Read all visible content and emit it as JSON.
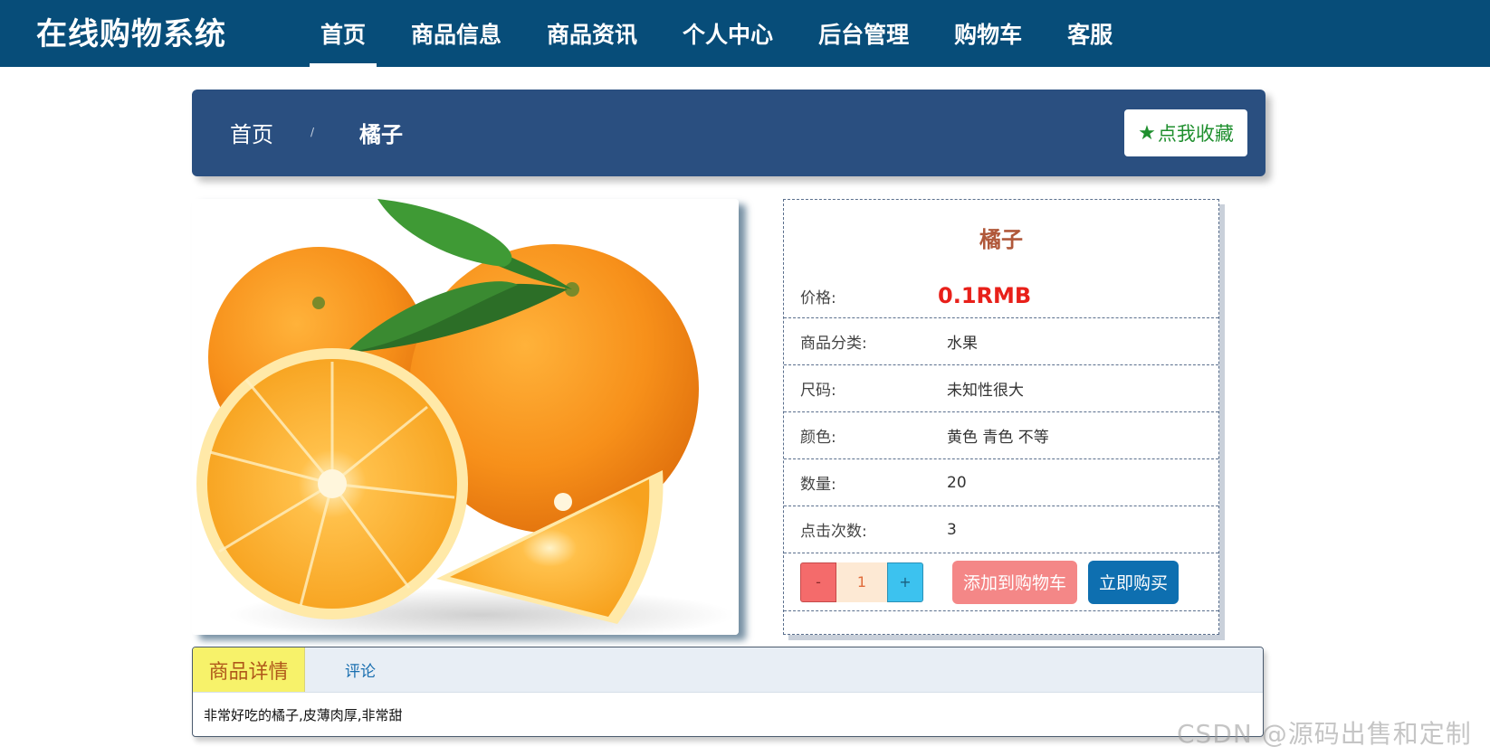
{
  "app": {
    "title": "在线购物系统"
  },
  "nav": {
    "items": [
      {
        "label": "首页",
        "active": true
      },
      {
        "label": "商品信息"
      },
      {
        "label": "商品资讯"
      },
      {
        "label": "个人中心"
      },
      {
        "label": "后台管理"
      },
      {
        "label": "购物车"
      },
      {
        "label": "客服"
      }
    ]
  },
  "breadcrumb": {
    "home": "首页",
    "separator": "/",
    "current": "橘子",
    "favorite_label": "点我收藏",
    "favorite_icon": "star-icon"
  },
  "product": {
    "name": "橘子",
    "image_alt": "orange-image",
    "rows": [
      {
        "label": "价格:",
        "value": "0.1RMB"
      },
      {
        "label": "商品分类:",
        "value": "水果"
      },
      {
        "label": "尺码:",
        "value": "未知性很大"
      },
      {
        "label": "颜色:",
        "value": "黄色 青色 不等"
      },
      {
        "label": "数量:",
        "value": "20"
      },
      {
        "label": "点击次数:",
        "value": "3"
      }
    ],
    "stepper": {
      "minus": "-",
      "value": "1",
      "plus": "+"
    },
    "add_to_cart": "添加到购物车",
    "buy_now": "立即购买"
  },
  "detail": {
    "tabs": [
      {
        "label": "商品详情",
        "active": true
      },
      {
        "label": "评论"
      }
    ],
    "text": "非常好吃的橘子,皮薄肉厚,非常甜"
  },
  "watermark": "CSDN @源码出售和定制",
  "colors": {
    "navbar": "#074d79",
    "breadcrumb": "#2a4f80",
    "price": "#e8201a",
    "title": "#b0583a",
    "cart_button": "#f48787",
    "buy_button": "#0e6fb0"
  }
}
